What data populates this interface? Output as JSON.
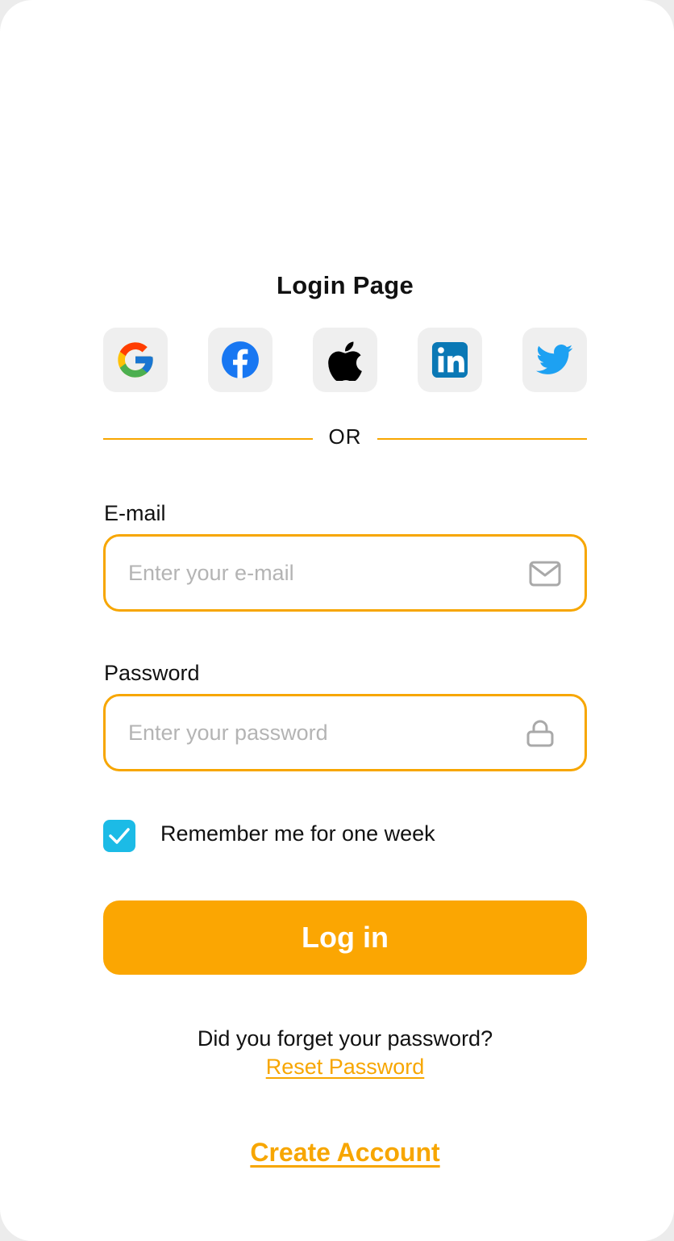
{
  "page": {
    "title": "Login Page"
  },
  "social": {
    "items": [
      {
        "name": "google",
        "icon": "google-icon"
      },
      {
        "name": "facebook",
        "icon": "facebook-icon"
      },
      {
        "name": "apple",
        "icon": "apple-icon"
      },
      {
        "name": "linkedin",
        "icon": "linkedin-icon"
      },
      {
        "name": "twitter",
        "icon": "twitter-icon"
      }
    ]
  },
  "divider": {
    "label": "OR"
  },
  "email": {
    "label": "E-mail",
    "placeholder": "Enter your e-mail",
    "value": "",
    "icon": "mail-icon"
  },
  "password": {
    "label": "Password",
    "placeholder": "Enter your password",
    "value": "",
    "icon": "lock-icon"
  },
  "remember": {
    "label": "Remember me for one week",
    "checked": true
  },
  "login": {
    "label": "Log in"
  },
  "forgot": {
    "text": "Did you forget your password?",
    "reset_label": "Reset Password"
  },
  "create": {
    "label": "Create Account"
  },
  "colors": {
    "accent": "#F7A600",
    "button": "#FBA602",
    "checkbox": "#1CBBE6",
    "social_bg": "#EFEFEF",
    "placeholder": "#B4B4B4"
  }
}
